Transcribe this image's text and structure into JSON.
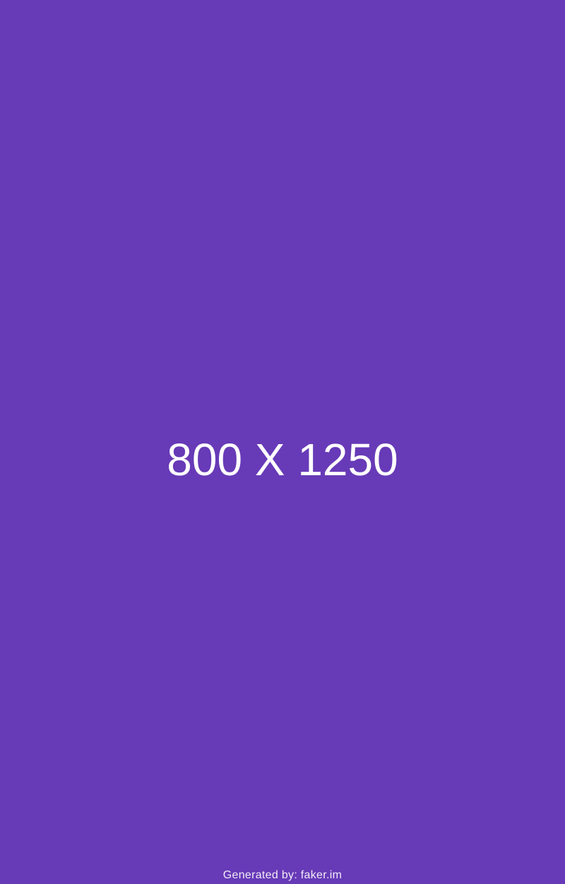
{
  "placeholder": {
    "background_color": "#673ab7",
    "dimensions_label": "800 X 1250",
    "credit": "Generated by: faker.im"
  }
}
